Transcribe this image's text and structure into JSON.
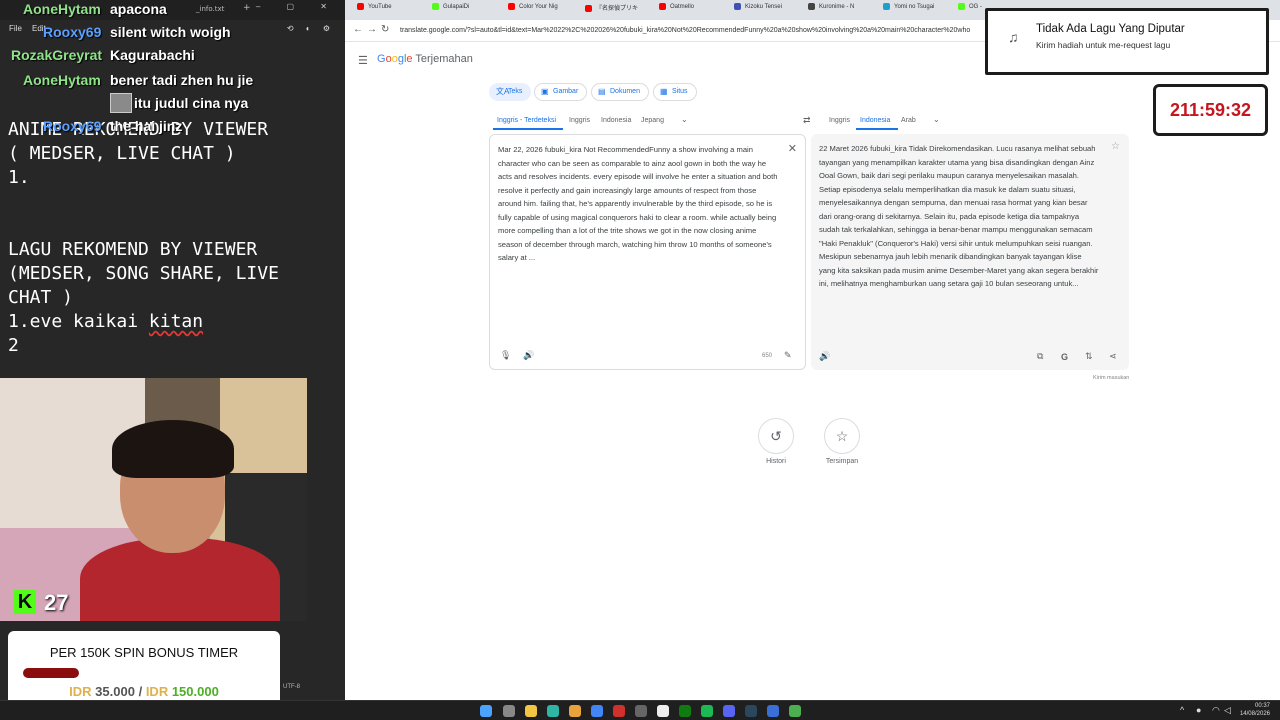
{
  "left_panel": {
    "notepad_tabs": [
      "_info.txt"
    ],
    "menu": {
      "file": "File",
      "edit": "Edit"
    },
    "text_lines": [
      "ANIME REKOMEND BY VIEWER",
      "( MEDSER, LIVE CHAT )",
      "1.",
      "",
      "",
      "LAGU REKOMEND BY VIEWER",
      "(MEDSER, SONG SHARE, LIVE",
      "CHAT )",
      "1.eve kaikai ",
      "2"
    ],
    "spell_word": "kitan",
    "encoding": "UTF-8"
  },
  "chat": [
    {
      "name": "AoneHytam",
      "message": "apacona",
      "color": "#8fe388"
    },
    {
      "name": "Rooxy69",
      "message": "silent witch woigh",
      "color": "#5aa0ff"
    },
    {
      "name": "RozakGreyrat",
      "message": "Kagurabachi",
      "color": "#8fe388"
    },
    {
      "name": "AoneHytam",
      "message": "bener tadi zhen hu jie",
      "color": "#8fe388"
    },
    {
      "name": "",
      "message": "itu judul cina nya",
      "color": "#ffffff"
    },
    {
      "name": "Rooxy69",
      "message": "the hai jinz",
      "color": "#5aa0ff"
    }
  ],
  "webcam": {
    "kick_count": "27",
    "kick_logo": "K"
  },
  "spin": {
    "title": "PER 150K SPIN BONUS TIMER",
    "current_currency": "IDR",
    "current_value": "35.000",
    "separator": "/",
    "target_currency": "IDR",
    "target_value": "150.000",
    "progress": 0.23
  },
  "browser": {
    "tabs": [
      "YouTube",
      "GulapaiDi",
      "Color Your Nig",
      "『名探偵プリキ",
      "Oatmello",
      "Kizoku Tensei",
      "Kuronime - N",
      "Yomi no Tsugai",
      "OG -"
    ],
    "url": "translate.google.com/?sl=auto&tl=id&text=Mar%2022%2C%202026%20fubuki_kira%20Not%20RecommendedFunny%20a%20show%20involving%20a%20main%20character%20who"
  },
  "translate": {
    "logo_google": "Google",
    "logo_product": "Terjemahan",
    "modes": [
      {
        "label": "Teks",
        "icon": "文A"
      },
      {
        "label": "Gambar",
        "icon": "▣"
      },
      {
        "label": "Dokumen",
        "icon": "▤"
      },
      {
        "label": "Situs",
        "icon": "▦"
      }
    ],
    "source_langs": [
      "Inggris - Terdeteksi",
      "Inggris",
      "Indonesia",
      "Jepang"
    ],
    "target_langs": [
      "Inggris",
      "Indonesia",
      "Arab"
    ],
    "source_text": "Mar 22, 2026 fubuki_kira Not RecommendedFunny a show involving a main character who can be seen as comparable to ainz aool gown in both the way he acts and resolves incidents. every episode will involve he enter a situation and both resolve it perfectly and gain increasingly large amounts of respect from those around him. failing that, he's apparently invulnerable by the third episode, so he is fully capable of using magical conquerors haki to clear a room. while actually being more compelling than a lot of the trite shows we got in the now closing anime season of december through march, watching him throw 10 months of someone's salary at ...",
    "target_text": "22 Maret 2026 fubuki_kira Tidak Direkomendasikan. Lucu rasanya melihat sebuah tayangan yang menampilkan karakter utama yang bisa disandingkan dengan Ainz Ooal Gown, baik dari segi perilaku maupun caranya menyelesaikan masalah. Setiap episodenya selalu memperlihatkan dia masuk ke dalam suatu situasi, menyelesaikannya dengan sempurna, dan menuai rasa hormat yang kian besar dari orang-orang di sekitarnya. Selain itu, pada episode ketiga dia tampaknya sudah tak terkalahkan, sehingga ia benar-benar mampu menggunakan semacam \"Haki Penakluk\" (Conqueror's Haki) versi sihir untuk melumpuhkan seisi ruangan. Meskipun sebenarnya jauh lebih menarik dibandingkan banyak tayangan klise yang kita saksikan pada musim anime Desember-Maret yang akan segera berakhir ini, melihatnya menghamburkan uang setara gaji 10 bulan seseorang untuk...",
    "char_count": "650",
    "feedback": "Kirim masukan",
    "history_label": "Histori",
    "saved_label": "Tersimpan"
  },
  "song": {
    "title": "Tidak Ada Lagu Yang Diputar",
    "subtitle": "Kirim hadiah untuk me-request lagu"
  },
  "timer": "211:59:32",
  "taskbar": {
    "time": "00:37",
    "date": "14/08/2026"
  },
  "icons": [
    "music-note-icon",
    "close-icon",
    "star-icon",
    "mic-icon",
    "speaker-icon",
    "copy-icon",
    "share-icon",
    "history-icon",
    "swap-icon",
    "hamburger-icon"
  ]
}
